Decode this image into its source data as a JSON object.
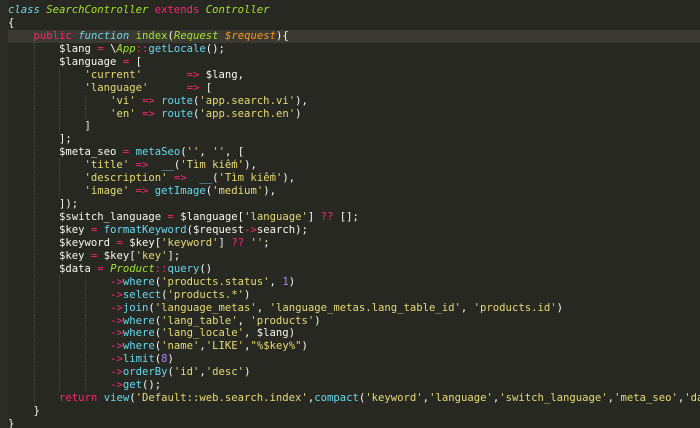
{
  "editor": {
    "theme_colors": {
      "background": "#272822",
      "keyword": "#f92672",
      "class_name": "#a6e22e",
      "function_call": "#66d9ef",
      "string": "#e6db74",
      "number": "#ae81ff",
      "parameter": "#fd971f",
      "plain": "#f8f8f2"
    },
    "lines": [
      {
        "tokens": [
          [
            "kwi",
            "class"
          ],
          [
            "pl",
            " "
          ],
          [
            "cls",
            "SearchController"
          ],
          [
            "pl",
            " "
          ],
          [
            "kw",
            "extends"
          ],
          [
            "pl",
            " "
          ],
          [
            "cls",
            "Controller"
          ]
        ]
      },
      {
        "tokens": [
          [
            "br",
            "{"
          ]
        ]
      },
      {
        "active": true,
        "tokens": [
          [
            "pl",
            "    "
          ],
          [
            "kw",
            "public"
          ],
          [
            "pl",
            " "
          ],
          [
            "kwi",
            "function"
          ],
          [
            "pl",
            " "
          ],
          [
            "fn",
            "index"
          ],
          [
            "br",
            "("
          ],
          [
            "cls",
            "Request"
          ],
          [
            "pl",
            " "
          ],
          [
            "par",
            "$request"
          ],
          [
            "br",
            "){"
          ]
        ]
      },
      {
        "tokens": [
          [
            "pl",
            "        "
          ],
          [
            "var",
            "$lang"
          ],
          [
            "pl",
            " "
          ],
          [
            "op",
            "="
          ],
          [
            "pl",
            " "
          ],
          [
            "var",
            "\\"
          ],
          [
            "cls",
            "App"
          ],
          [
            "op",
            "::"
          ],
          [
            "fnc",
            "getLocale"
          ],
          [
            "pl",
            "();"
          ]
        ]
      },
      {
        "tokens": [
          [
            "pl",
            "        "
          ],
          [
            "var",
            "$language"
          ],
          [
            "pl",
            " "
          ],
          [
            "op",
            "="
          ],
          [
            "pl",
            " ["
          ]
        ]
      },
      {
        "tokens": [
          [
            "pl",
            "            "
          ],
          [
            "str",
            "'current'"
          ],
          [
            "pl",
            "       "
          ],
          [
            "op",
            "=>"
          ],
          [
            "pl",
            " "
          ],
          [
            "var",
            "$lang"
          ],
          [
            "pl",
            ","
          ]
        ]
      },
      {
        "tokens": [
          [
            "pl",
            "            "
          ],
          [
            "str",
            "'language'"
          ],
          [
            "pl",
            "      "
          ],
          [
            "op",
            "=>"
          ],
          [
            "pl",
            " ["
          ]
        ]
      },
      {
        "tokens": [
          [
            "pl",
            "                "
          ],
          [
            "str",
            "'vi'"
          ],
          [
            "pl",
            " "
          ],
          [
            "op",
            "=>"
          ],
          [
            "pl",
            " "
          ],
          [
            "fnc",
            "route"
          ],
          [
            "pl",
            "("
          ],
          [
            "str",
            "'app.search.vi'"
          ],
          [
            "pl",
            "),"
          ]
        ]
      },
      {
        "tokens": [
          [
            "pl",
            "                "
          ],
          [
            "str",
            "'en'"
          ],
          [
            "pl",
            " "
          ],
          [
            "op",
            "=>"
          ],
          [
            "pl",
            " "
          ],
          [
            "fnc",
            "route"
          ],
          [
            "pl",
            "("
          ],
          [
            "str",
            "'app.search.en'"
          ],
          [
            "pl",
            ")"
          ]
        ]
      },
      {
        "tokens": [
          [
            "pl",
            "            ]"
          ]
        ]
      },
      {
        "tokens": [
          [
            "pl",
            "        ];"
          ]
        ]
      },
      {
        "tokens": [
          [
            "pl",
            "        "
          ],
          [
            "var",
            "$meta_seo"
          ],
          [
            "pl",
            " "
          ],
          [
            "op",
            "="
          ],
          [
            "pl",
            " "
          ],
          [
            "fnc",
            "metaSeo"
          ],
          [
            "pl",
            "("
          ],
          [
            "str",
            "''"
          ],
          [
            "pl",
            ", "
          ],
          [
            "str",
            "''"
          ],
          [
            "pl",
            ", ["
          ]
        ]
      },
      {
        "tokens": [
          [
            "pl",
            "            "
          ],
          [
            "str",
            "'title'"
          ],
          [
            "pl",
            " "
          ],
          [
            "op",
            "=>"
          ],
          [
            "pl",
            "  "
          ],
          [
            "fnc",
            "__"
          ],
          [
            "pl",
            "("
          ],
          [
            "str",
            "'Tìm kiếm'"
          ],
          [
            "pl",
            "),"
          ]
        ]
      },
      {
        "tokens": [
          [
            "pl",
            "            "
          ],
          [
            "str",
            "'description'"
          ],
          [
            "pl",
            " "
          ],
          [
            "op",
            "=>"
          ],
          [
            "pl",
            "  "
          ],
          [
            "fnc",
            "__"
          ],
          [
            "pl",
            "("
          ],
          [
            "str",
            "'Tìm kiếm'"
          ],
          [
            "pl",
            "),"
          ]
        ]
      },
      {
        "tokens": [
          [
            "pl",
            "            "
          ],
          [
            "str",
            "'image'"
          ],
          [
            "pl",
            " "
          ],
          [
            "op",
            "=>"
          ],
          [
            "pl",
            " "
          ],
          [
            "fnc",
            "getImage"
          ],
          [
            "pl",
            "("
          ],
          [
            "str",
            "'medium'"
          ],
          [
            "pl",
            "),"
          ]
        ]
      },
      {
        "tokens": [
          [
            "pl",
            "        ]);"
          ]
        ]
      },
      {
        "tokens": [
          [
            "pl",
            "        "
          ],
          [
            "var",
            "$switch_language"
          ],
          [
            "pl",
            " "
          ],
          [
            "op",
            "="
          ],
          [
            "pl",
            " "
          ],
          [
            "var",
            "$language"
          ],
          [
            "pl",
            "["
          ],
          [
            "str",
            "'language'"
          ],
          [
            "pl",
            "] "
          ],
          [
            "op",
            "??"
          ],
          [
            "pl",
            " [];"
          ]
        ]
      },
      {
        "tokens": [
          [
            "pl",
            "        "
          ],
          [
            "var",
            "$key"
          ],
          [
            "pl",
            " "
          ],
          [
            "op",
            "="
          ],
          [
            "pl",
            " "
          ],
          [
            "fnc",
            "formatKeyword"
          ],
          [
            "pl",
            "("
          ],
          [
            "var",
            "$request"
          ],
          [
            "op",
            "->"
          ],
          [
            "pl",
            "search);"
          ]
        ]
      },
      {
        "tokens": [
          [
            "pl",
            "        "
          ],
          [
            "var",
            "$keyword"
          ],
          [
            "pl",
            " "
          ],
          [
            "op",
            "="
          ],
          [
            "pl",
            " "
          ],
          [
            "var",
            "$key"
          ],
          [
            "pl",
            "["
          ],
          [
            "str",
            "'keyword'"
          ],
          [
            "pl",
            "] "
          ],
          [
            "op",
            "??"
          ],
          [
            "pl",
            " "
          ],
          [
            "str",
            "''"
          ],
          [
            "pl",
            ";"
          ]
        ]
      },
      {
        "tokens": [
          [
            "pl",
            "        "
          ],
          [
            "var",
            "$key"
          ],
          [
            "pl",
            " "
          ],
          [
            "op",
            "="
          ],
          [
            "pl",
            " "
          ],
          [
            "var",
            "$key"
          ],
          [
            "pl",
            "["
          ],
          [
            "str",
            "'key'"
          ],
          [
            "pl",
            "];"
          ]
        ]
      },
      {
        "tokens": [
          [
            "pl",
            "        "
          ],
          [
            "var",
            "$data"
          ],
          [
            "pl",
            " "
          ],
          [
            "op",
            "="
          ],
          [
            "pl",
            " "
          ],
          [
            "cls",
            "Product"
          ],
          [
            "op",
            "::"
          ],
          [
            "fnc",
            "query"
          ],
          [
            "pl",
            "()"
          ]
        ]
      },
      {
        "tokens": [
          [
            "pl",
            "                "
          ],
          [
            "op",
            "->"
          ],
          [
            "fnc",
            "where"
          ],
          [
            "pl",
            "("
          ],
          [
            "str",
            "'products.status'"
          ],
          [
            "pl",
            ", "
          ],
          [
            "num",
            "1"
          ],
          [
            "pl",
            ")"
          ]
        ]
      },
      {
        "tokens": [
          [
            "pl",
            "                "
          ],
          [
            "op",
            "->"
          ],
          [
            "fnc",
            "select"
          ],
          [
            "pl",
            "("
          ],
          [
            "str",
            "'products.*'"
          ],
          [
            "pl",
            ")"
          ]
        ]
      },
      {
        "tokens": [
          [
            "pl",
            "                "
          ],
          [
            "op",
            "->"
          ],
          [
            "fnc",
            "join"
          ],
          [
            "pl",
            "("
          ],
          [
            "str",
            "'language_metas'"
          ],
          [
            "pl",
            ", "
          ],
          [
            "str",
            "'language_metas.lang_table_id'"
          ],
          [
            "pl",
            ", "
          ],
          [
            "str",
            "'products.id'"
          ],
          [
            "pl",
            ")"
          ]
        ]
      },
      {
        "tokens": [
          [
            "pl",
            "                "
          ],
          [
            "op",
            "->"
          ],
          [
            "fnc",
            "where"
          ],
          [
            "pl",
            "("
          ],
          [
            "str",
            "'lang_table'"
          ],
          [
            "pl",
            ", "
          ],
          [
            "str",
            "'products'"
          ],
          [
            "pl",
            ")"
          ]
        ]
      },
      {
        "tokens": [
          [
            "pl",
            "                "
          ],
          [
            "op",
            "->"
          ],
          [
            "fnc",
            "where"
          ],
          [
            "pl",
            "("
          ],
          [
            "str",
            "'lang_locale'"
          ],
          [
            "pl",
            ", "
          ],
          [
            "var",
            "$lang"
          ],
          [
            "pl",
            ")"
          ]
        ]
      },
      {
        "tokens": [
          [
            "pl",
            "                "
          ],
          [
            "op",
            "->"
          ],
          [
            "fnc",
            "where"
          ],
          [
            "pl",
            "("
          ],
          [
            "str",
            "'name'"
          ],
          [
            "pl",
            ","
          ],
          [
            "str",
            "'LIKE'"
          ],
          [
            "pl",
            ","
          ],
          [
            "str",
            "\"%$key%\""
          ],
          [
            "pl",
            ")"
          ]
        ]
      },
      {
        "tokens": [
          [
            "pl",
            "                "
          ],
          [
            "op",
            "->"
          ],
          [
            "fnc",
            "limit"
          ],
          [
            "pl",
            "("
          ],
          [
            "num",
            "8"
          ],
          [
            "pl",
            ")"
          ]
        ]
      },
      {
        "tokens": [
          [
            "pl",
            "                "
          ],
          [
            "op",
            "->"
          ],
          [
            "fnc",
            "orderBy"
          ],
          [
            "pl",
            "("
          ],
          [
            "str",
            "'id'"
          ],
          [
            "pl",
            ","
          ],
          [
            "str",
            "'desc'"
          ],
          [
            "pl",
            ")"
          ]
        ]
      },
      {
        "tokens": [
          [
            "pl",
            "                "
          ],
          [
            "op",
            "->"
          ],
          [
            "fnc",
            "get"
          ],
          [
            "pl",
            "();"
          ]
        ]
      },
      {
        "tokens": [
          [
            "pl",
            "        "
          ],
          [
            "kw",
            "return"
          ],
          [
            "pl",
            " "
          ],
          [
            "fnc",
            "view"
          ],
          [
            "pl",
            "("
          ],
          [
            "str",
            "'Default::web.search.index'"
          ],
          [
            "pl",
            ","
          ],
          [
            "fnc",
            "compact"
          ],
          [
            "pl",
            "("
          ],
          [
            "str",
            "'keyword'"
          ],
          [
            "pl",
            ","
          ],
          [
            "str",
            "'language'"
          ],
          [
            "pl",
            ","
          ],
          [
            "str",
            "'switch_language'"
          ],
          [
            "pl",
            ","
          ],
          [
            "str",
            "'meta_seo'"
          ],
          [
            "pl",
            ","
          ],
          [
            "str",
            "'data'"
          ],
          [
            "pl",
            "));"
          ]
        ]
      },
      {
        "tokens": [
          [
            "pl",
            "    }"
          ]
        ]
      },
      {
        "tokens": [
          [
            "br",
            "}"
          ]
        ]
      }
    ]
  }
}
